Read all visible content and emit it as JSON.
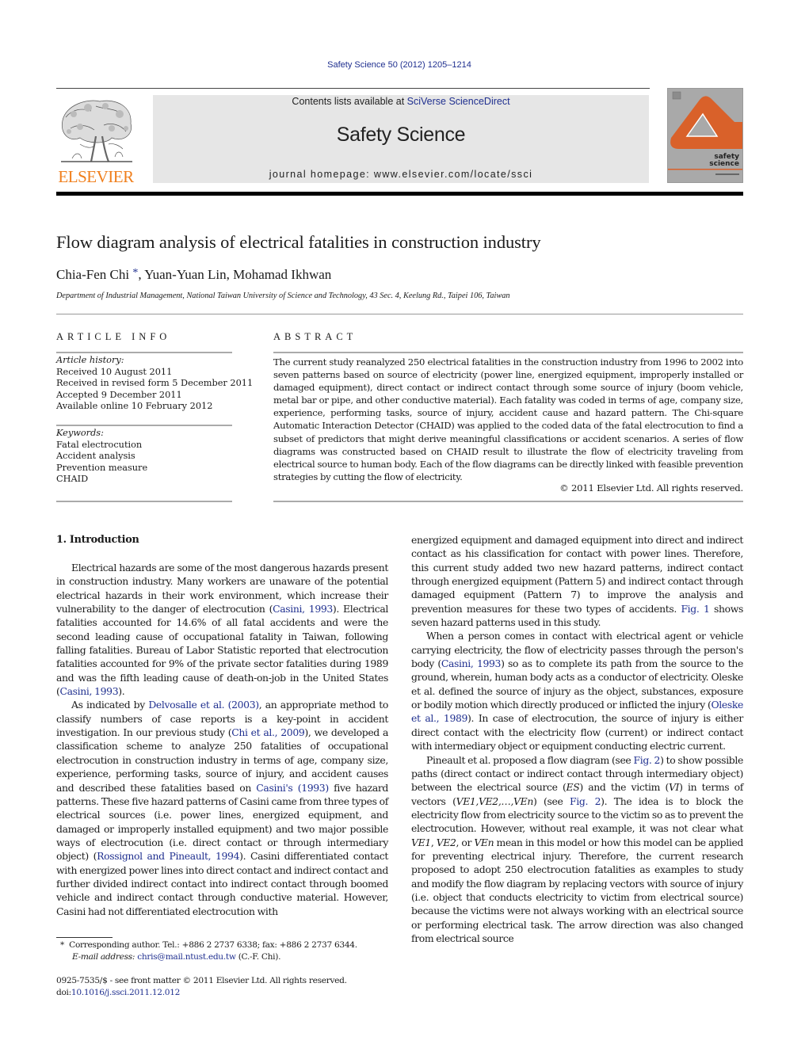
{
  "citation": "Safety Science 50 (2012) 1205–1214",
  "header": {
    "publisher_wordmark": "ELSEVIER",
    "contents_prefix": "Contents lists available at ",
    "contents_link": "SciVerse ScienceDirect",
    "journal_name": "Safety Science",
    "homepage_label": "journal homepage: www.elsevier.com/locate/ssci",
    "cover_text_line1": "safety",
    "cover_text_line2": "science",
    "colors": {
      "elsevier_orange": "#f07f1c",
      "cover_orange": "#d9612a",
      "cover_gray": "#a9a9a9",
      "masthead_gray": "#e6e6e6",
      "link_blue": "#1f2f8f"
    }
  },
  "article": {
    "title": "Flow diagram analysis of electrical fatalities in construction industry",
    "authors": [
      {
        "name": "Chia-Fen Chi",
        "marker": "*"
      },
      {
        "name": "Yuan-Yuan Lin"
      },
      {
        "name": "Mohamad Ikhwan"
      }
    ],
    "author_sep": ", ",
    "affiliation": "Department of Industrial Management, National Taiwan University of Science and Technology, 43 Sec. 4, Keelung Rd., Taipei 106, Taiwan"
  },
  "article_info": {
    "heading": "ARTICLE INFO",
    "history_label": "Article history:",
    "history": [
      "Received 10 August 2011",
      "Received in revised form 5 December 2011",
      "Accepted 9 December 2011",
      "Available online 10 February 2012"
    ],
    "keywords_label": "Keywords:",
    "keywords": [
      "Fatal electrocution",
      "Accident analysis",
      "Prevention measure",
      "CHAID"
    ]
  },
  "abstract": {
    "heading": "ABSTRACT",
    "text": "The current study reanalyzed 250 electrical fatalities in the construction industry from 1996 to 2002 into seven patterns based on source of electricity (power line, energized equipment, improperly installed or damaged equipment), direct contact or indirect contact through some source of injury (boom vehicle, metal bar or pipe, and other conductive material). Each fatality was coded in terms of age, company size, experience, performing tasks, source of injury, accident cause and hazard pattern. The Chi-square Automatic Interaction Detector (CHAID) was applied to the coded data of the fatal electrocution to find a subset of predictors that might derive meaningful classifications or accident scenarios. A series of flow diagrams was constructed based on CHAID result to illustrate the flow of electricity traveling from electrical source to human body. Each of the flow diagrams can be directly linked with feasible prevention strategies by cutting the flow of electricity.",
    "copyright": "© 2011 Elsevier Ltd. All rights reserved."
  },
  "body": {
    "section_heading": "1. Introduction",
    "left": {
      "p1": [
        {
          "t": "Electrical hazards are some of the most dangerous hazards present in construction industry. Many workers are unaware of the potential electrical hazards in their work environment, which increase their vulnerability to the danger of electrocution ("
        },
        {
          "t": "Casini, 1993",
          "link": true
        },
        {
          "t": "). Electrical fatalities accounted for 14.6% of all fatal accidents and were the second leading cause of occupational fatality in Taiwan, following falling fatalities. Bureau of Labor Statistic reported that electrocution fatalities accounted for 9% of the private sector fatalities during 1989 and was the fifth leading cause of death-on-job in the United States ("
        },
        {
          "t": "Casini, 1993",
          "link": true
        },
        {
          "t": ")."
        }
      ],
      "p2": [
        {
          "t": "As indicated by "
        },
        {
          "t": "Delvosalle et al. (2003)",
          "link": true
        },
        {
          "t": ", an appropriate method to classify numbers of case reports is a key-point in accident investigation. In our previous study ("
        },
        {
          "t": "Chi et al., 2009",
          "link": true
        },
        {
          "t": "), we developed a classification scheme to analyze 250 fatalities of occupational electrocution in construction industry in terms of age, company size, experience, performing tasks, source of injury, and accident causes and described these fatalities based on "
        },
        {
          "t": "Casini's (1993)",
          "link": true
        },
        {
          "t": " five hazard patterns. These five hazard patterns of Casini came from three types of electrical sources (i.e. power lines, energized equipment, and damaged or improperly installed equipment) and two major possible ways of electrocution (i.e. direct contact or through intermediary object) ("
        },
        {
          "t": "Rossignol and Pineault, 1994",
          "link": true
        },
        {
          "t": "). Casini differentiated contact with energized power lines into direct contact and indirect contact and further divided indirect contact into indirect contact through boomed vehicle and indirect contact through conductive material. However, Casini had not differentiated electrocution with"
        }
      ]
    },
    "right": {
      "p1": [
        {
          "t": "energized equipment and damaged equipment into direct and indirect contact as his classification for contact with power lines. Therefore, this current study added two new hazard patterns, indirect contact through energized equipment (Pattern 5) and indirect contact through damaged equipment (Pattern 7) to improve the analysis and prevention measures for these two types of accidents. "
        },
        {
          "t": "Fig. 1",
          "link": true
        },
        {
          "t": " shows seven hazard patterns used in this study."
        }
      ],
      "p2": [
        {
          "t": "When a person comes in contact with electrical agent or vehicle carrying electricity, the flow of electricity passes through the person's body ("
        },
        {
          "t": "Casini, 1993",
          "link": true
        },
        {
          "t": ") so as to complete its path from the source to the ground, wherein, human body acts as a conductor of electricity. Oleske et al. defined the source of injury as the object, substances, exposure or bodily motion which directly produced or inflicted the injury ("
        },
        {
          "t": "Oleske et al., 1989",
          "link": true
        },
        {
          "t": "). In case of electrocution, the source of injury is either direct contact with the electricity flow (current) or indirect contact with intermediary object or equipment conducting electric current."
        }
      ],
      "p3": [
        {
          "t": "Pineault et al. proposed a flow diagram (see "
        },
        {
          "t": "Fig. 2",
          "link": true
        },
        {
          "t": ") to show possible paths (direct contact or indirect contact through intermediary object) between the electrical source ("
        },
        {
          "t": "ES",
          "italic": true
        },
        {
          "t": ") and the victim ("
        },
        {
          "t": "VI",
          "italic": true
        },
        {
          "t": ") in terms of vectors ("
        },
        {
          "t": "VE1,VE2,…,VEn",
          "italic": true
        },
        {
          "t": ") (see "
        },
        {
          "t": "Fig. 2",
          "link": true
        },
        {
          "t": "). The idea is to block the electricity flow from electricity source to the victim so as to prevent the electrocution. However, without real example, it was not clear what "
        },
        {
          "t": "VE1",
          "italic": true
        },
        {
          "t": ", "
        },
        {
          "t": "VE2",
          "italic": true
        },
        {
          "t": ", or "
        },
        {
          "t": "VEn",
          "italic": true
        },
        {
          "t": " mean in this model or how this model can be applied for preventing electrical injury. Therefore, the current research proposed to adopt 250 electrocution fatalities as examples to study and modify the flow diagram by replacing vectors with source of injury (i.e. object that conducts electricity to victim from electrical source) because the victims were not always working with an electrical source or performing electrical task. The arrow direction was also changed from electrical source"
        }
      ]
    }
  },
  "footnote": {
    "marker": "*",
    "line1": "Corresponding author. Tel.: +886 2 2737 6338; fax: +886 2 2737 6344.",
    "email_label": "E-mail address:",
    "email": "chris@mail.ntust.edu.tw",
    "email_suffix": " (C.-F. Chi)."
  },
  "issn": {
    "line1": "0925-7535/$ - see front matter © 2011 Elsevier Ltd. All rights reserved.",
    "doi_prefix": "doi:",
    "doi": "10.1016/j.ssci.2011.12.012"
  }
}
